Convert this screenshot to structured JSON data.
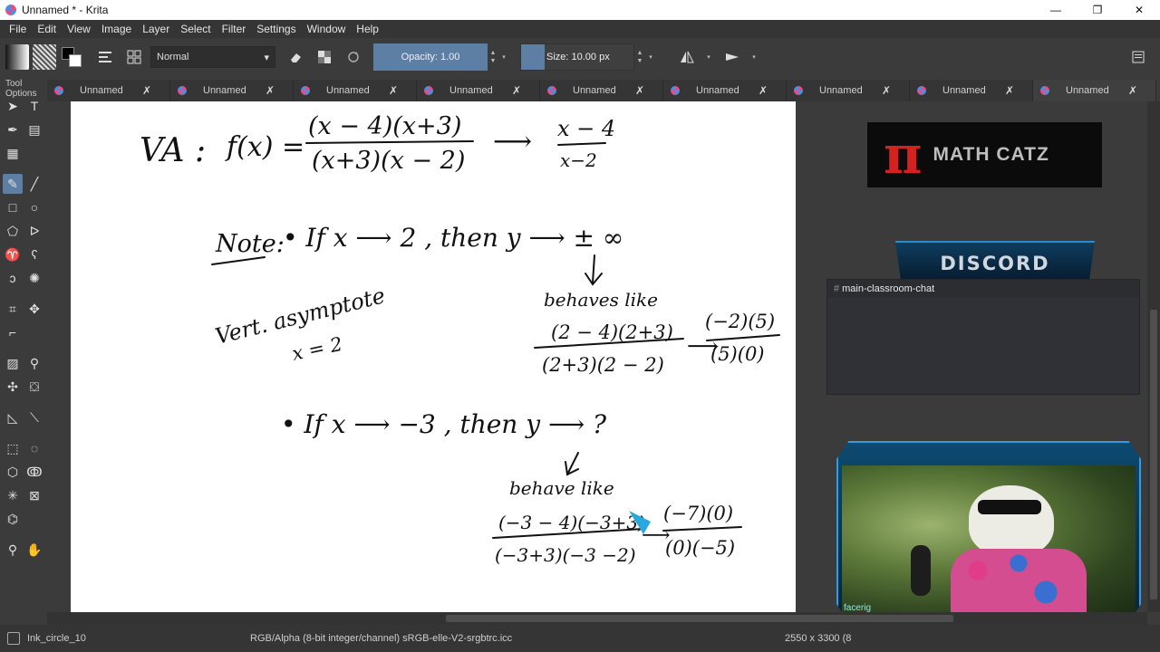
{
  "window": {
    "title": "Unnamed * - Krita",
    "controls": {
      "minimize": "—",
      "restore": "❐",
      "close": "✕"
    }
  },
  "menu": [
    "File",
    "Edit",
    "View",
    "Image",
    "Layer",
    "Select",
    "Filter",
    "Settings",
    "Window",
    "Help"
  ],
  "toolbar": {
    "blend_mode": "Normal",
    "opacity_label": "Opacity:  1.00",
    "size_label": "Size:  10.00 px"
  },
  "toolbox": {
    "header": "Tool Options"
  },
  "tabs": [
    {
      "label": "Unnamed",
      "close": "✗"
    },
    {
      "label": "Unnamed",
      "close": "✗"
    },
    {
      "label": "Unnamed",
      "close": "✗"
    },
    {
      "label": "Unnamed",
      "close": "✗"
    },
    {
      "label": "Unnamed",
      "close": "✗"
    },
    {
      "label": "Unnamed",
      "close": "✗"
    },
    {
      "label": "Unnamed",
      "close": "✗"
    },
    {
      "label": "Unnamed",
      "close": "✗"
    },
    {
      "label": "Unnamed",
      "close": "✗"
    }
  ],
  "canvas": {
    "handwriting": {
      "va": "VA :",
      "func": "f(x) =",
      "num1": "(x − 4)(x+3)",
      "den1": "(x+3)(x − 2)",
      "arrow": "⟶",
      "num2": "x − 4",
      "den2": "x−2",
      "note": "Note:",
      "bullet1": "• If  x ⟶ 2  , then  y ⟶ ± ∞",
      "behaves1": "behaves like",
      "num3": "(2 − 4)(2+3)",
      "den3": "(2+3)(2 − 2)",
      "num4": "(−2)(5)",
      "den4": "(5)(0)",
      "vert": "Vert. asymptote",
      "xeq": "x = 2",
      "bullet2": "• If  x ⟶ −3 ,  then  y ⟶  ?",
      "behaves2": "behave like",
      "num5": "(−3 − 4)(−3+3)",
      "den5": "(−3+3)(−3 −2)",
      "num6": "(−7)(0)",
      "den6": "(0)(−5)"
    }
  },
  "overlay": {
    "logo_symbol": "π",
    "logo_text": "MATH CATZ",
    "discord": "DISCORD",
    "chat_channel": "main-classroom-chat",
    "cam_watermark": "facerig"
  },
  "status": {
    "brush": "Ink_circle_10",
    "colorspace": "RGB/Alpha (8-bit integer/channel)  sRGB-elle-V2-srgbtrc.icc",
    "dims": "2550 x 3300 (8"
  }
}
